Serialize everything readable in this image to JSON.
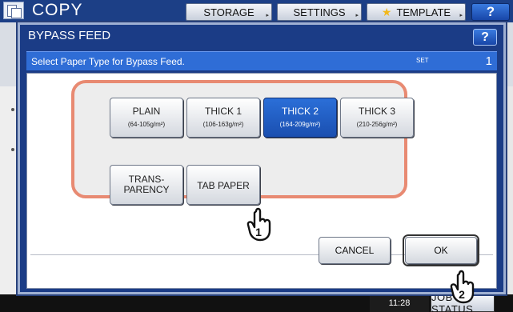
{
  "app": {
    "title": "COPY",
    "top_buttons": [
      {
        "label": "STORAGE"
      },
      {
        "label": "SETTINGS"
      },
      {
        "label": "TEMPLATE"
      }
    ],
    "help_label": "?"
  },
  "footer": {
    "time": "11:28",
    "job_status_label": "JOB STATUS"
  },
  "dialog": {
    "title": "BYPASS FEED",
    "help_label": "?",
    "message": "Select Paper Type for Bypass Feed.",
    "set_label": "SET",
    "set_count": "1",
    "paper_types": [
      {
        "label": "PLAIN",
        "weight": "(64-105g/m²)",
        "selected": false
      },
      {
        "label": "THICK 1",
        "weight": "(106-163g/m²)",
        "selected": false
      },
      {
        "label": "THICK 2",
        "weight": "(164-209g/m²)",
        "selected": true
      },
      {
        "label": "THICK 3",
        "weight": "(210-256g/m²)",
        "selected": false
      },
      {
        "label": "TRANS-\nPARENCY",
        "weight": "",
        "selected": false
      },
      {
        "label": "TAB PAPER",
        "weight": "",
        "selected": false
      }
    ],
    "cancel_label": "CANCEL",
    "ok_label": "OK"
  },
  "callouts": [
    {
      "number": "1"
    },
    {
      "number": "2"
    }
  ],
  "colors": {
    "title_bar": "#1c3f86",
    "message_bar": "#2f6dd6",
    "selected_button": "#1a4fb0",
    "highlight_border": "#e88a72"
  },
  "icons": [
    "copy-icon",
    "star-icon",
    "help-icon",
    "pointing-hand-icon"
  ]
}
